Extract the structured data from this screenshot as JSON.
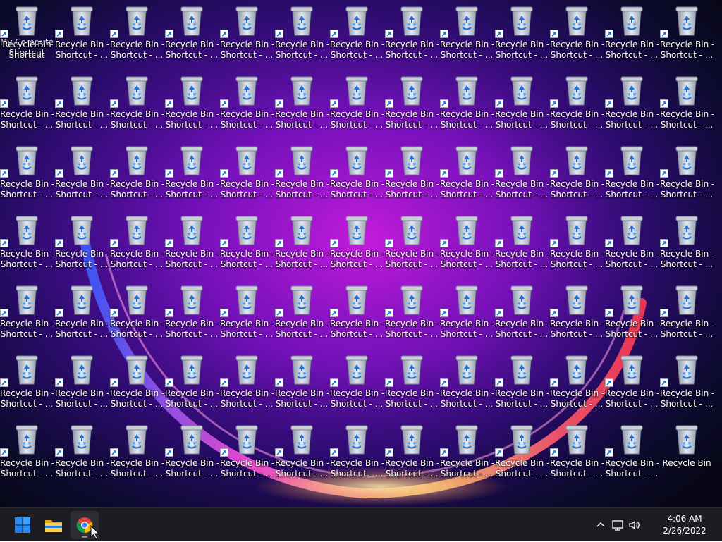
{
  "desktop": {
    "overlay_text_1": "My Computer",
    "overlay_text_2": "Shortcut",
    "icons": [
      {
        "line1": "Recycle Bin",
        "line2": "Shortcut",
        "shortcut": true
      },
      {
        "line1": "Recycle Bin -",
        "line2": "Shortcut - ...",
        "shortcut": true
      },
      {
        "line1": "Recycle Bin -",
        "line2": "Shortcut - ...",
        "shortcut": true
      },
      {
        "line1": "Recycle Bin -",
        "line2": "Shortcut - ...",
        "shortcut": true
      },
      {
        "line1": "Recycle Bin -",
        "line2": "Shortcut - ...",
        "shortcut": true
      },
      {
        "line1": "Recycle Bin -",
        "line2": "Shortcut - ...",
        "shortcut": true
      },
      {
        "line1": "Recycle Bin -",
        "line2": "Shortcut - ...",
        "shortcut": true
      },
      {
        "line1": "Recycle Bin -",
        "line2": "Shortcut - ...",
        "shortcut": true
      },
      {
        "line1": "Recycle Bin -",
        "line2": "Shortcut - ...",
        "shortcut": true
      },
      {
        "line1": "Recycle Bin -",
        "line2": "Shortcut - ...",
        "shortcut": true
      },
      {
        "line1": "Recycle Bin -",
        "line2": "Shortcut - ...",
        "shortcut": true
      },
      {
        "line1": "Recycle Bin -",
        "line2": "Shortcut - ...",
        "shortcut": true
      },
      {
        "line1": "Recycle Bin -",
        "line2": "Shortcut - ...",
        "shortcut": true
      },
      {
        "line1": "Recycle Bin -",
        "line2": "Shortcut - ...",
        "shortcut": true
      },
      {
        "line1": "Recycle Bin -",
        "line2": "Shortcut - ...",
        "shortcut": true
      },
      {
        "line1": "Recycle Bin -",
        "line2": "Shortcut - ...",
        "shortcut": true
      },
      {
        "line1": "Recycle Bin -",
        "line2": "Shortcut - ...",
        "shortcut": true
      },
      {
        "line1": "Recycle Bin -",
        "line2": "Shortcut - ...",
        "shortcut": true
      },
      {
        "line1": "Recycle Bin -",
        "line2": "Shortcut - ...",
        "shortcut": true
      },
      {
        "line1": "Recycle Bin -",
        "line2": "Shortcut - ...",
        "shortcut": true
      },
      {
        "line1": "Recycle Bin -",
        "line2": "Shortcut - ...",
        "shortcut": true
      },
      {
        "line1": "Recycle Bin -",
        "line2": "Shortcut - ...",
        "shortcut": true
      },
      {
        "line1": "Recycle Bin -",
        "line2": "Shortcut - ...",
        "shortcut": true
      },
      {
        "line1": "Recycle Bin -",
        "line2": "Shortcut - ...",
        "shortcut": true
      },
      {
        "line1": "Recycle Bin -",
        "line2": "Shortcut - ...",
        "shortcut": true
      },
      {
        "line1": "Recycle Bin -",
        "line2": "Shortcut - ...",
        "shortcut": true
      },
      {
        "line1": "Recycle Bin -",
        "line2": "Shortcut - ...",
        "shortcut": true
      },
      {
        "line1": "Recycle Bin -",
        "line2": "Shortcut - ...",
        "shortcut": true
      },
      {
        "line1": "Recycle Bin -",
        "line2": "Shortcut - ...",
        "shortcut": true
      },
      {
        "line1": "Recycle Bin -",
        "line2": "Shortcut - ...",
        "shortcut": true
      },
      {
        "line1": "Recycle Bin -",
        "line2": "Shortcut - ...",
        "shortcut": true
      },
      {
        "line1": "Recycle Bin -",
        "line2": "Shortcut - ...",
        "shortcut": true
      },
      {
        "line1": "Recycle Bin -",
        "line2": "Shortcut - ...",
        "shortcut": true
      },
      {
        "line1": "Recycle Bin -",
        "line2": "Shortcut - ...",
        "shortcut": true
      },
      {
        "line1": "Recycle Bin -",
        "line2": "Shortcut - ...",
        "shortcut": true
      },
      {
        "line1": "Recycle Bin -",
        "line2": "Shortcut - ...",
        "shortcut": true
      },
      {
        "line1": "Recycle Bin -",
        "line2": "Shortcut - ...",
        "shortcut": true
      },
      {
        "line1": "Recycle Bin -",
        "line2": "Shortcut - ...",
        "shortcut": true
      },
      {
        "line1": "Recycle Bin -",
        "line2": "Shortcut - ...",
        "shortcut": true
      },
      {
        "line1": "Recycle Bin -",
        "line2": "Shortcut - ...",
        "shortcut": true
      },
      {
        "line1": "Recycle Bin -",
        "line2": "Shortcut - ...",
        "shortcut": true
      },
      {
        "line1": "Recycle Bin -",
        "line2": "Shortcut - ...",
        "shortcut": true
      },
      {
        "line1": "Recycle Bin -",
        "line2": "Shortcut - ...",
        "shortcut": true
      },
      {
        "line1": "Recycle Bin -",
        "line2": "Shortcut - ...",
        "shortcut": true
      },
      {
        "line1": "Recycle Bin -",
        "line2": "Shortcut - ...",
        "shortcut": true
      },
      {
        "line1": "Recycle Bin -",
        "line2": "Shortcut - ...",
        "shortcut": true
      },
      {
        "line1": "Recycle Bin -",
        "line2": "Shortcut - ...",
        "shortcut": true
      },
      {
        "line1": "Recycle Bin -",
        "line2": "Shortcut - ...",
        "shortcut": true
      },
      {
        "line1": "Recycle Bin -",
        "line2": "Shortcut - ...",
        "shortcut": true
      },
      {
        "line1": "Recycle Bin -",
        "line2": "Shortcut - ...",
        "shortcut": true
      },
      {
        "line1": "Recycle Bin -",
        "line2": "Shortcut - ...",
        "shortcut": true
      },
      {
        "line1": "Recycle Bin -",
        "line2": "Shortcut - ...",
        "shortcut": true
      },
      {
        "line1": "Recycle Bin -",
        "line2": "Shortcut - ...",
        "shortcut": true
      },
      {
        "line1": "Recycle Bin -",
        "line2": "Shortcut - ...",
        "shortcut": true
      },
      {
        "line1": "Recycle Bin -",
        "line2": "Shortcut - ...",
        "shortcut": true
      },
      {
        "line1": "Recycle Bin -",
        "line2": "Shortcut - ...",
        "shortcut": true
      },
      {
        "line1": "Recycle Bin -",
        "line2": "Shortcut - ...",
        "shortcut": true
      },
      {
        "line1": "Recycle Bin -",
        "line2": "Shortcut - ...",
        "shortcut": true
      },
      {
        "line1": "Recycle Bin -",
        "line2": "Shortcut - ...",
        "shortcut": true
      },
      {
        "line1": "Recycle Bin -",
        "line2": "Shortcut - ...",
        "shortcut": true
      },
      {
        "line1": "Recycle Bin -",
        "line2": "Shortcut - ...",
        "shortcut": true
      },
      {
        "line1": "Recycle Bin -",
        "line2": "Shortcut - ...",
        "shortcut": true
      },
      {
        "line1": "Recycle Bin -",
        "line2": "Shortcut - ...",
        "shortcut": true
      },
      {
        "line1": "Recycle Bin -",
        "line2": "Shortcut - ...",
        "shortcut": true
      },
      {
        "line1": "Recycle Bin -",
        "line2": "Shortcut - ...",
        "shortcut": true
      },
      {
        "line1": "Recycle Bin -",
        "line2": "Shortcut - ...",
        "shortcut": true
      },
      {
        "line1": "Recycle Bin -",
        "line2": "Shortcut - ...",
        "shortcut": true
      },
      {
        "line1": "Recycle Bin -",
        "line2": "Shortcut - ...",
        "shortcut": true
      },
      {
        "line1": "Recycle Bin -",
        "line2": "Shortcut - ...",
        "shortcut": true
      },
      {
        "line1": "Recycle Bin -",
        "line2": "Shortcut - ...",
        "shortcut": true
      },
      {
        "line1": "Recycle Bin -",
        "line2": "Shortcut - ...",
        "shortcut": true
      },
      {
        "line1": "Recycle Bin -",
        "line2": "Shortcut - ...",
        "shortcut": true
      },
      {
        "line1": "Recycle Bin -",
        "line2": "Shortcut - ...",
        "shortcut": true
      },
      {
        "line1": "Recycle Bin -",
        "line2": "Shortcut - ...",
        "shortcut": true
      },
      {
        "line1": "Recycle Bin -",
        "line2": "Shortcut - ...",
        "shortcut": true
      },
      {
        "line1": "Recycle Bin -",
        "line2": "Shortcut - ...",
        "shortcut": true
      },
      {
        "line1": "Recycle Bin -",
        "line2": "Shortcut - ...",
        "shortcut": true
      },
      {
        "line1": "Recycle Bin -",
        "line2": "Shortcut - ...",
        "shortcut": true
      },
      {
        "line1": "Recycle Bin -",
        "line2": "Shortcut - ...",
        "shortcut": true
      },
      {
        "line1": "Recycle Bin -",
        "line2": "Shortcut - ...",
        "shortcut": true
      },
      {
        "line1": "Recycle Bin -",
        "line2": "Shortcut - ...",
        "shortcut": true
      },
      {
        "line1": "Recycle Bin -",
        "line2": "Shortcut - ...",
        "shortcut": true
      },
      {
        "line1": "Recycle Bin -",
        "line2": "Shortcut - ...",
        "shortcut": true
      },
      {
        "line1": "Recycle Bin -",
        "line2": "Shortcut - ...",
        "shortcut": true
      },
      {
        "line1": "Recycle Bin -",
        "line2": "Shortcut - ...",
        "shortcut": true
      },
      {
        "line1": "Recycle Bin -",
        "line2": "Shortcut - ...",
        "shortcut": true
      },
      {
        "line1": "Recycle Bin -",
        "line2": "Shortcut - ...",
        "shortcut": true
      },
      {
        "line1": "Recycle Bin -",
        "line2": "Shortcut - ...",
        "shortcut": true
      },
      {
        "line1": "Recycle Bin -",
        "line2": "Shortcut - ...",
        "shortcut": true
      },
      {
        "line1": "Recycle Bin -",
        "line2": "Shortcut - ...",
        "shortcut": true
      },
      {
        "line1": "Recycle Bin",
        "line2": "",
        "shortcut": false
      }
    ]
  },
  "taskbar": {
    "start_icon": "windows-start-icon",
    "pinned": [
      {
        "name": "file-explorer",
        "icon": "folder-icon",
        "active": false
      },
      {
        "name": "chrome",
        "icon": "chrome-icon",
        "active": true
      }
    ],
    "tray": {
      "overflow_icon": "chevron-up-icon",
      "network_icon": "network-icon",
      "volume_icon": "volume-icon",
      "time": "4:06 AM",
      "date": "2/26/2022"
    }
  },
  "colors": {
    "taskbar_bg": "#1c1c22",
    "start_blue": "#2a8cf0",
    "folder_yellow": "#f4c23a",
    "recycle_blue": "#1f6fd6"
  }
}
